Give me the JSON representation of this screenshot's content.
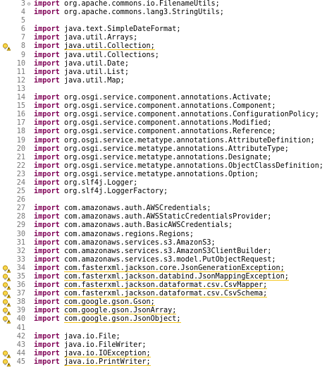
{
  "editor": {
    "lines": [
      {
        "num": "3",
        "fold": "⊖",
        "kw": "import",
        "pkg": "org.apache.commons.io.FilenameUtils;",
        "warn": false
      },
      {
        "num": "4",
        "kw": "import",
        "pkg": "org.apache.commons.lang3.StringUtils;",
        "warn": false
      },
      {
        "num": "5",
        "kw": "",
        "pkg": "",
        "warn": false
      },
      {
        "num": "6",
        "kw": "import",
        "pkg": "java.text.SimpleDateFormat;",
        "warn": false
      },
      {
        "num": "7",
        "kw": "import",
        "pkg": "java.util.Arrays;",
        "warn": false
      },
      {
        "num": "8",
        "kw": "import",
        "pkg": "java.util.Collection;",
        "warn": true
      },
      {
        "num": "9",
        "kw": "import",
        "pkg": "java.util.Collections;",
        "warn": false
      },
      {
        "num": "10",
        "kw": "import",
        "pkg": "java.util.Date;",
        "warn": false
      },
      {
        "num": "11",
        "kw": "import",
        "pkg": "java.util.List;",
        "warn": false
      },
      {
        "num": "12",
        "kw": "import",
        "pkg": "java.util.Map;",
        "warn": false
      },
      {
        "num": "13",
        "kw": "",
        "pkg": "",
        "warn": false
      },
      {
        "num": "14",
        "kw": "import",
        "pkg": "org.osgi.service.component.annotations.Activate;",
        "warn": false
      },
      {
        "num": "15",
        "kw": "import",
        "pkg": "org.osgi.service.component.annotations.Component;",
        "warn": false
      },
      {
        "num": "16",
        "kw": "import",
        "pkg": "org.osgi.service.component.annotations.ConfigurationPolicy;",
        "warn": false
      },
      {
        "num": "17",
        "kw": "import",
        "pkg": "org.osgi.service.component.annotations.Modified;",
        "warn": false
      },
      {
        "num": "18",
        "kw": "import",
        "pkg": "org.osgi.service.component.annotations.Reference;",
        "warn": false
      },
      {
        "num": "19",
        "kw": "import",
        "pkg": "org.osgi.service.metatype.annotations.AttributeDefinition;",
        "warn": false
      },
      {
        "num": "20",
        "kw": "import",
        "pkg": "org.osgi.service.metatype.annotations.AttributeType;",
        "warn": false
      },
      {
        "num": "21",
        "kw": "import",
        "pkg": "org.osgi.service.metatype.annotations.Designate;",
        "warn": false
      },
      {
        "num": "22",
        "kw": "import",
        "pkg": "org.osgi.service.metatype.annotations.ObjectClassDefinition;",
        "warn": false
      },
      {
        "num": "23",
        "kw": "import",
        "pkg": "org.osgi.service.metatype.annotations.Option;",
        "warn": false
      },
      {
        "num": "24",
        "kw": "import",
        "pkg": "org.slf4j.Logger;",
        "warn": false
      },
      {
        "num": "25",
        "kw": "import",
        "pkg": "org.slf4j.LoggerFactory;",
        "warn": false
      },
      {
        "num": "26",
        "kw": "",
        "pkg": "",
        "warn": false
      },
      {
        "num": "27",
        "kw": "import",
        "pkg": "com.amazonaws.auth.AWSCredentials;",
        "warn": false
      },
      {
        "num": "28",
        "kw": "import",
        "pkg": "com.amazonaws.auth.AWSStaticCredentialsProvider;",
        "warn": false
      },
      {
        "num": "29",
        "kw": "import",
        "pkg": "com.amazonaws.auth.BasicAWSCredentials;",
        "warn": false
      },
      {
        "num": "30",
        "kw": "import",
        "pkg": "com.amazonaws.regions.Regions;",
        "warn": false
      },
      {
        "num": "31",
        "kw": "import",
        "pkg": "com.amazonaws.services.s3.AmazonS3;",
        "warn": false
      },
      {
        "num": "32",
        "kw": "import",
        "pkg": "com.amazonaws.services.s3.AmazonS3ClientBuilder;",
        "warn": false
      },
      {
        "num": "33",
        "kw": "import",
        "pkg": "com.amazonaws.services.s3.model.PutObjectRequest;",
        "warn": false
      },
      {
        "num": "34",
        "kw": "import",
        "pkg": "com.fasterxml.jackson.core.JsonGenerationException;",
        "warn": true
      },
      {
        "num": "35",
        "kw": "import",
        "pkg": "com.fasterxml.jackson.databind.JsonMappingException;",
        "warn": true
      },
      {
        "num": "36",
        "kw": "import",
        "pkg": "com.fasterxml.jackson.dataformat.csv.CsvMapper;",
        "warn": true
      },
      {
        "num": "37",
        "kw": "import",
        "pkg": "com.fasterxml.jackson.dataformat.csv.CsvSchema;",
        "warn": true
      },
      {
        "num": "38",
        "kw": "import",
        "pkg": "com.google.gson.Gson;",
        "warn": true
      },
      {
        "num": "39",
        "kw": "import",
        "pkg": "com.google.gson.JsonArray;",
        "warn": true
      },
      {
        "num": "40",
        "kw": "import",
        "pkg": "com.google.gson.JsonObject;",
        "warn": true
      },
      {
        "num": "41",
        "kw": "",
        "pkg": "",
        "warn": false
      },
      {
        "num": "42",
        "kw": "import",
        "pkg": "java.io.File;",
        "warn": false
      },
      {
        "num": "43",
        "kw": "import",
        "pkg": "java.io.FileWriter;",
        "warn": false
      },
      {
        "num": "44",
        "kw": "import",
        "pkg": "java.io.IOException;",
        "warn": true
      },
      {
        "num": "45",
        "kw": "import",
        "pkg": "java.io.PrintWriter;",
        "warn": true
      }
    ]
  },
  "icons": {
    "warning": "warning-lightbulb-icon",
    "fold": "fold-collapse-icon"
  },
  "colors": {
    "keyword": "#7f0055",
    "line_number": "#787878",
    "warning_underline": "#f5c518"
  }
}
